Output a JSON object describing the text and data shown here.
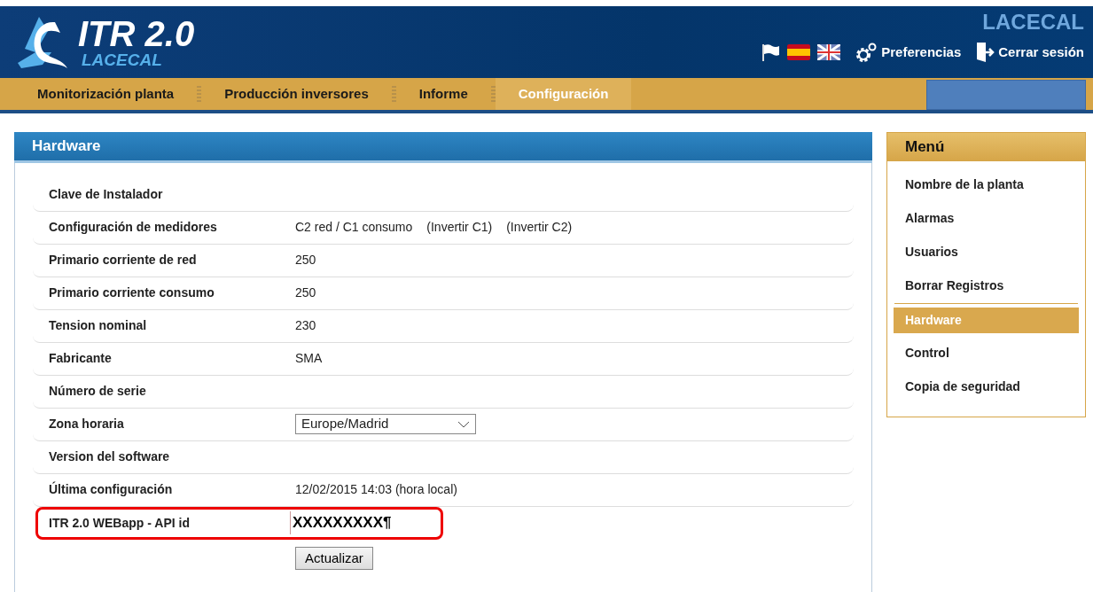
{
  "header": {
    "logo_title": "ITR 2.0",
    "logo_subtitle": "LACECAL",
    "company": "LACECAL",
    "links": [
      {
        "kind": "preferences",
        "label": "Preferencias"
      },
      {
        "kind": "logout",
        "label": "Cerrar sesión"
      }
    ]
  },
  "nav": [
    {
      "label": "Monitorización planta",
      "selected": false
    },
    {
      "label": "Producción inversores",
      "selected": false
    },
    {
      "label": "Informe",
      "selected": false
    },
    {
      "label": "Configuración",
      "selected": true
    }
  ],
  "panel": {
    "title": "Hardware",
    "rows": [
      {
        "label": "Clave de Instalador",
        "kind": "text",
        "highlighted": false
      },
      {
        "label": "Configuración de medidores",
        "kind": "text",
        "value": "C2 red / C1 consumo",
        "links": [
          "(Invertir C1)",
          "(Invertir C2)"
        ],
        "highlighted": false
      },
      {
        "label": "Primario corriente de red",
        "kind": "text",
        "value": "250",
        "highlighted": false
      },
      {
        "label": "Primario corriente consumo",
        "kind": "text",
        "value": "250",
        "highlighted": false
      },
      {
        "label": "Tension nominal",
        "kind": "text",
        "value": "230",
        "highlighted": false
      },
      {
        "label": "Fabricante",
        "kind": "text",
        "value": "SMA",
        "highlighted": false
      },
      {
        "label": "Número de serie",
        "kind": "text",
        "highlighted": false
      },
      {
        "label": "Zona horaria",
        "kind": "select",
        "value": "Europe/Madrid",
        "highlighted": false
      },
      {
        "label": "Version del software",
        "kind": "text",
        "highlighted": false
      },
      {
        "label": "Última configuración",
        "kind": "text",
        "value": "12/02/2015 14:03 (hora local)",
        "highlighted": false
      },
      {
        "label": "ITR 2.0 WEBapp - API id",
        "kind": "input",
        "value": "XXXXXXXXX¶",
        "highlighted": true
      }
    ],
    "button": "Actualizar"
  },
  "menu": {
    "title": "Menú",
    "items": [
      {
        "label": "Nombre de la planta",
        "selected": false
      },
      {
        "label": "Alarmas",
        "selected": false
      },
      {
        "label": "Usuarios",
        "selected": false
      },
      {
        "label": "Borrar Registros",
        "selected": false
      },
      {
        "label": "Hardware",
        "selected": true
      },
      {
        "label": "Control",
        "selected": false
      },
      {
        "label": "Copia de seguridad",
        "selected": false
      }
    ]
  }
}
